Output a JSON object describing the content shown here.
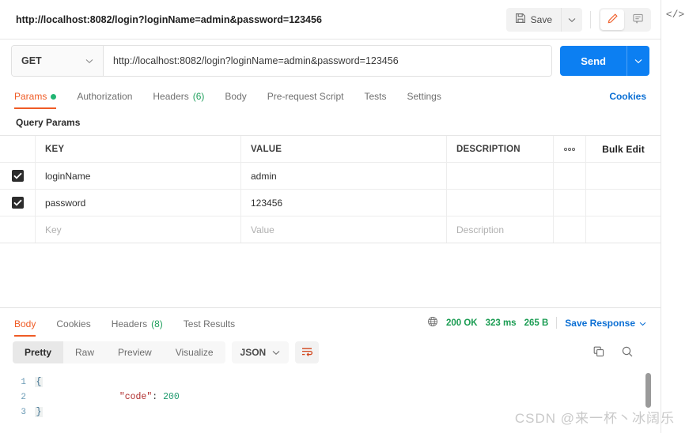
{
  "request": {
    "title": "http://localhost:8082/login?loginName=admin&password=123456",
    "save_label": "Save",
    "method": "GET",
    "url": "http://localhost:8082/login?loginName=admin&password=123456",
    "send_label": "Send"
  },
  "request_tabs": [
    {
      "label": "Params",
      "active": true,
      "dot": true
    },
    {
      "label": "Authorization",
      "active": false
    },
    {
      "label": "Headers",
      "count": "(6)",
      "active": false
    },
    {
      "label": "Body",
      "active": false
    },
    {
      "label": "Pre-request Script",
      "active": false
    },
    {
      "label": "Tests",
      "active": false
    },
    {
      "label": "Settings",
      "active": false
    }
  ],
  "cookies_link": "Cookies",
  "query_params": {
    "section_title": "Query Params",
    "columns": [
      "KEY",
      "VALUE",
      "DESCRIPTION"
    ],
    "dots_label": "●●●",
    "bulk_edit_label": "Bulk Edit",
    "rows": [
      {
        "checked": true,
        "key": "loginName",
        "value": "admin",
        "description": ""
      },
      {
        "checked": true,
        "key": "password",
        "value": "123456",
        "description": ""
      }
    ],
    "placeholder_row": {
      "key": "Key",
      "value": "Value",
      "description": "Description"
    }
  },
  "response": {
    "tabs": [
      {
        "label": "Body",
        "active": true
      },
      {
        "label": "Cookies",
        "active": false
      },
      {
        "label": "Headers",
        "count": "(8)",
        "active": false
      },
      {
        "label": "Test Results",
        "active": false
      }
    ],
    "status": "200 OK",
    "time": "323 ms",
    "size": "265 B",
    "save_response_label": "Save Response",
    "view_modes": [
      {
        "label": "Pretty",
        "active": true
      },
      {
        "label": "Raw",
        "active": false
      },
      {
        "label": "Preview",
        "active": false
      },
      {
        "label": "Visualize",
        "active": false
      }
    ],
    "format": "JSON",
    "body_lines": [
      {
        "num": "1",
        "fold": "{",
        "text": ""
      },
      {
        "num": "2",
        "fold": "",
        "key": "\"code\"",
        "punct": ": ",
        "num_val": "200"
      },
      {
        "num": "3",
        "fold": "}",
        "text": ""
      }
    ]
  },
  "colors": {
    "accent_orange": "#ef5b25",
    "send_blue": "#0c7ff2",
    "link_blue": "#0b6fd4",
    "status_green": "#1a9c52"
  },
  "watermark": "CSDN @来一杯丶冰阔乐"
}
